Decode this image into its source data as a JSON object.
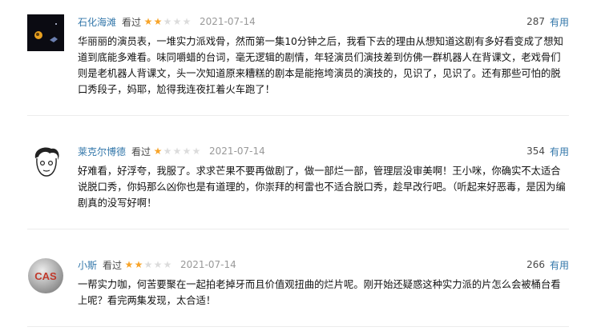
{
  "reviews": [
    {
      "author": "石化海滩",
      "watched": "看过",
      "rating": 2,
      "date": "2021-07-14",
      "votes": "287",
      "useful_label": "有用",
      "content": "华丽丽的演员表，一堆实力派戏骨，然而第一集10分钟之后，我看下去的理由从想知道这剧有多好看变成了想知道到底能多难看。味同嚼蜡的台词，毫无逻辑的剧情，年轻演员们演技差到仿佛一群机器人在背课文，老戏骨们则是老机器人背课文，头一次知道原来糟糕的剧本是能拖垮演员的演技的，见识了，见识了。还有那些可怕的脱口秀段子，妈耶，尬得我连夜扛着火车跑了！"
    },
    {
      "author": "莱克尔博德",
      "watched": "看过",
      "rating": 1,
      "date": "2021-07-14",
      "votes": "354",
      "useful_label": "有用",
      "content": "好难看，好浮夸，我服了。求求芒果不要再做剧了，做一部烂一部，管理层没审美啊！王小咪，你确实不太适合说脱口秀，你妈那么凶你也是有道理的，你崇拜的柯雷也不适合脱口秀，趁早改行吧。（听起来好恶毒，是因为编剧真的没写好啊！"
    },
    {
      "author": "小斯",
      "watched": "看过",
      "rating": 2,
      "date": "2021-07-14",
      "votes": "266",
      "useful_label": "有用",
      "content": "一帮实力咖，何苦要聚在一起拍老掉牙而且价值观扭曲的烂片呢。刚开始还疑惑这种实力派的片怎么会被桶台看上呢？看完两集发现，太合适！",
      "avatar_text": "CAS"
    }
  ]
}
